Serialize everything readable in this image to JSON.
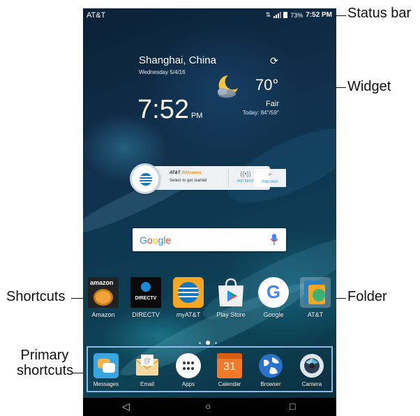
{
  "callouts": {
    "status_bar": "Status bar",
    "widget": "Widget",
    "shortcuts": "Shortcuts",
    "folder": "Folder",
    "primary_line1": "Primary",
    "primary_line2": "shortcuts"
  },
  "status_bar": {
    "carrier": "AT&T",
    "battery": "73%",
    "time": "7:52 PM"
  },
  "weather_widget": {
    "city": "Shanghai, China",
    "date": "Wednesday 5/4/16",
    "time": "7:52",
    "ampm": "PM",
    "temperature": "70°",
    "condition": "Fair",
    "range": "Today: 84°/59°",
    "icon": "moon-cloud-icon"
  },
  "allaccess_widget": {
    "brand": "AT&T",
    "product": "AllAccess",
    "subtitle": "Select to get started",
    "hotspot_label": "HOTSPOT",
    "findwifi_label": "FIND WIFI"
  },
  "search": {
    "logo": [
      "G",
      "o",
      "o",
      "g",
      "l",
      "e"
    ]
  },
  "shortcuts": [
    {
      "label": "Amazon",
      "icon": "amazon-icon",
      "logo_text": "amazon"
    },
    {
      "label": "DIRECTV",
      "icon": "directv-icon",
      "logo_text": "DIRECTV"
    },
    {
      "label": "myAT&T",
      "icon": "myatt-icon"
    },
    {
      "label": "Play Store",
      "icon": "play-store-icon"
    },
    {
      "label": "Google",
      "icon": "google-icon",
      "logo_text": "G"
    },
    {
      "label": "AT&T",
      "icon": "att-folder-icon"
    }
  ],
  "page_indicator": {
    "count": 3,
    "active": 1
  },
  "primary_shortcuts": [
    {
      "label": "Messages",
      "icon": "messages-icon"
    },
    {
      "label": "Email",
      "icon": "email-icon"
    },
    {
      "label": "Apps",
      "icon": "apps-icon"
    },
    {
      "label": "Calendar",
      "icon": "calendar-icon",
      "day": "31"
    },
    {
      "label": "Browser",
      "icon": "browser-icon"
    },
    {
      "label": "Camera",
      "icon": "camera-icon"
    }
  ],
  "nav": {
    "back": "◁",
    "home": "○",
    "recents": "□"
  }
}
